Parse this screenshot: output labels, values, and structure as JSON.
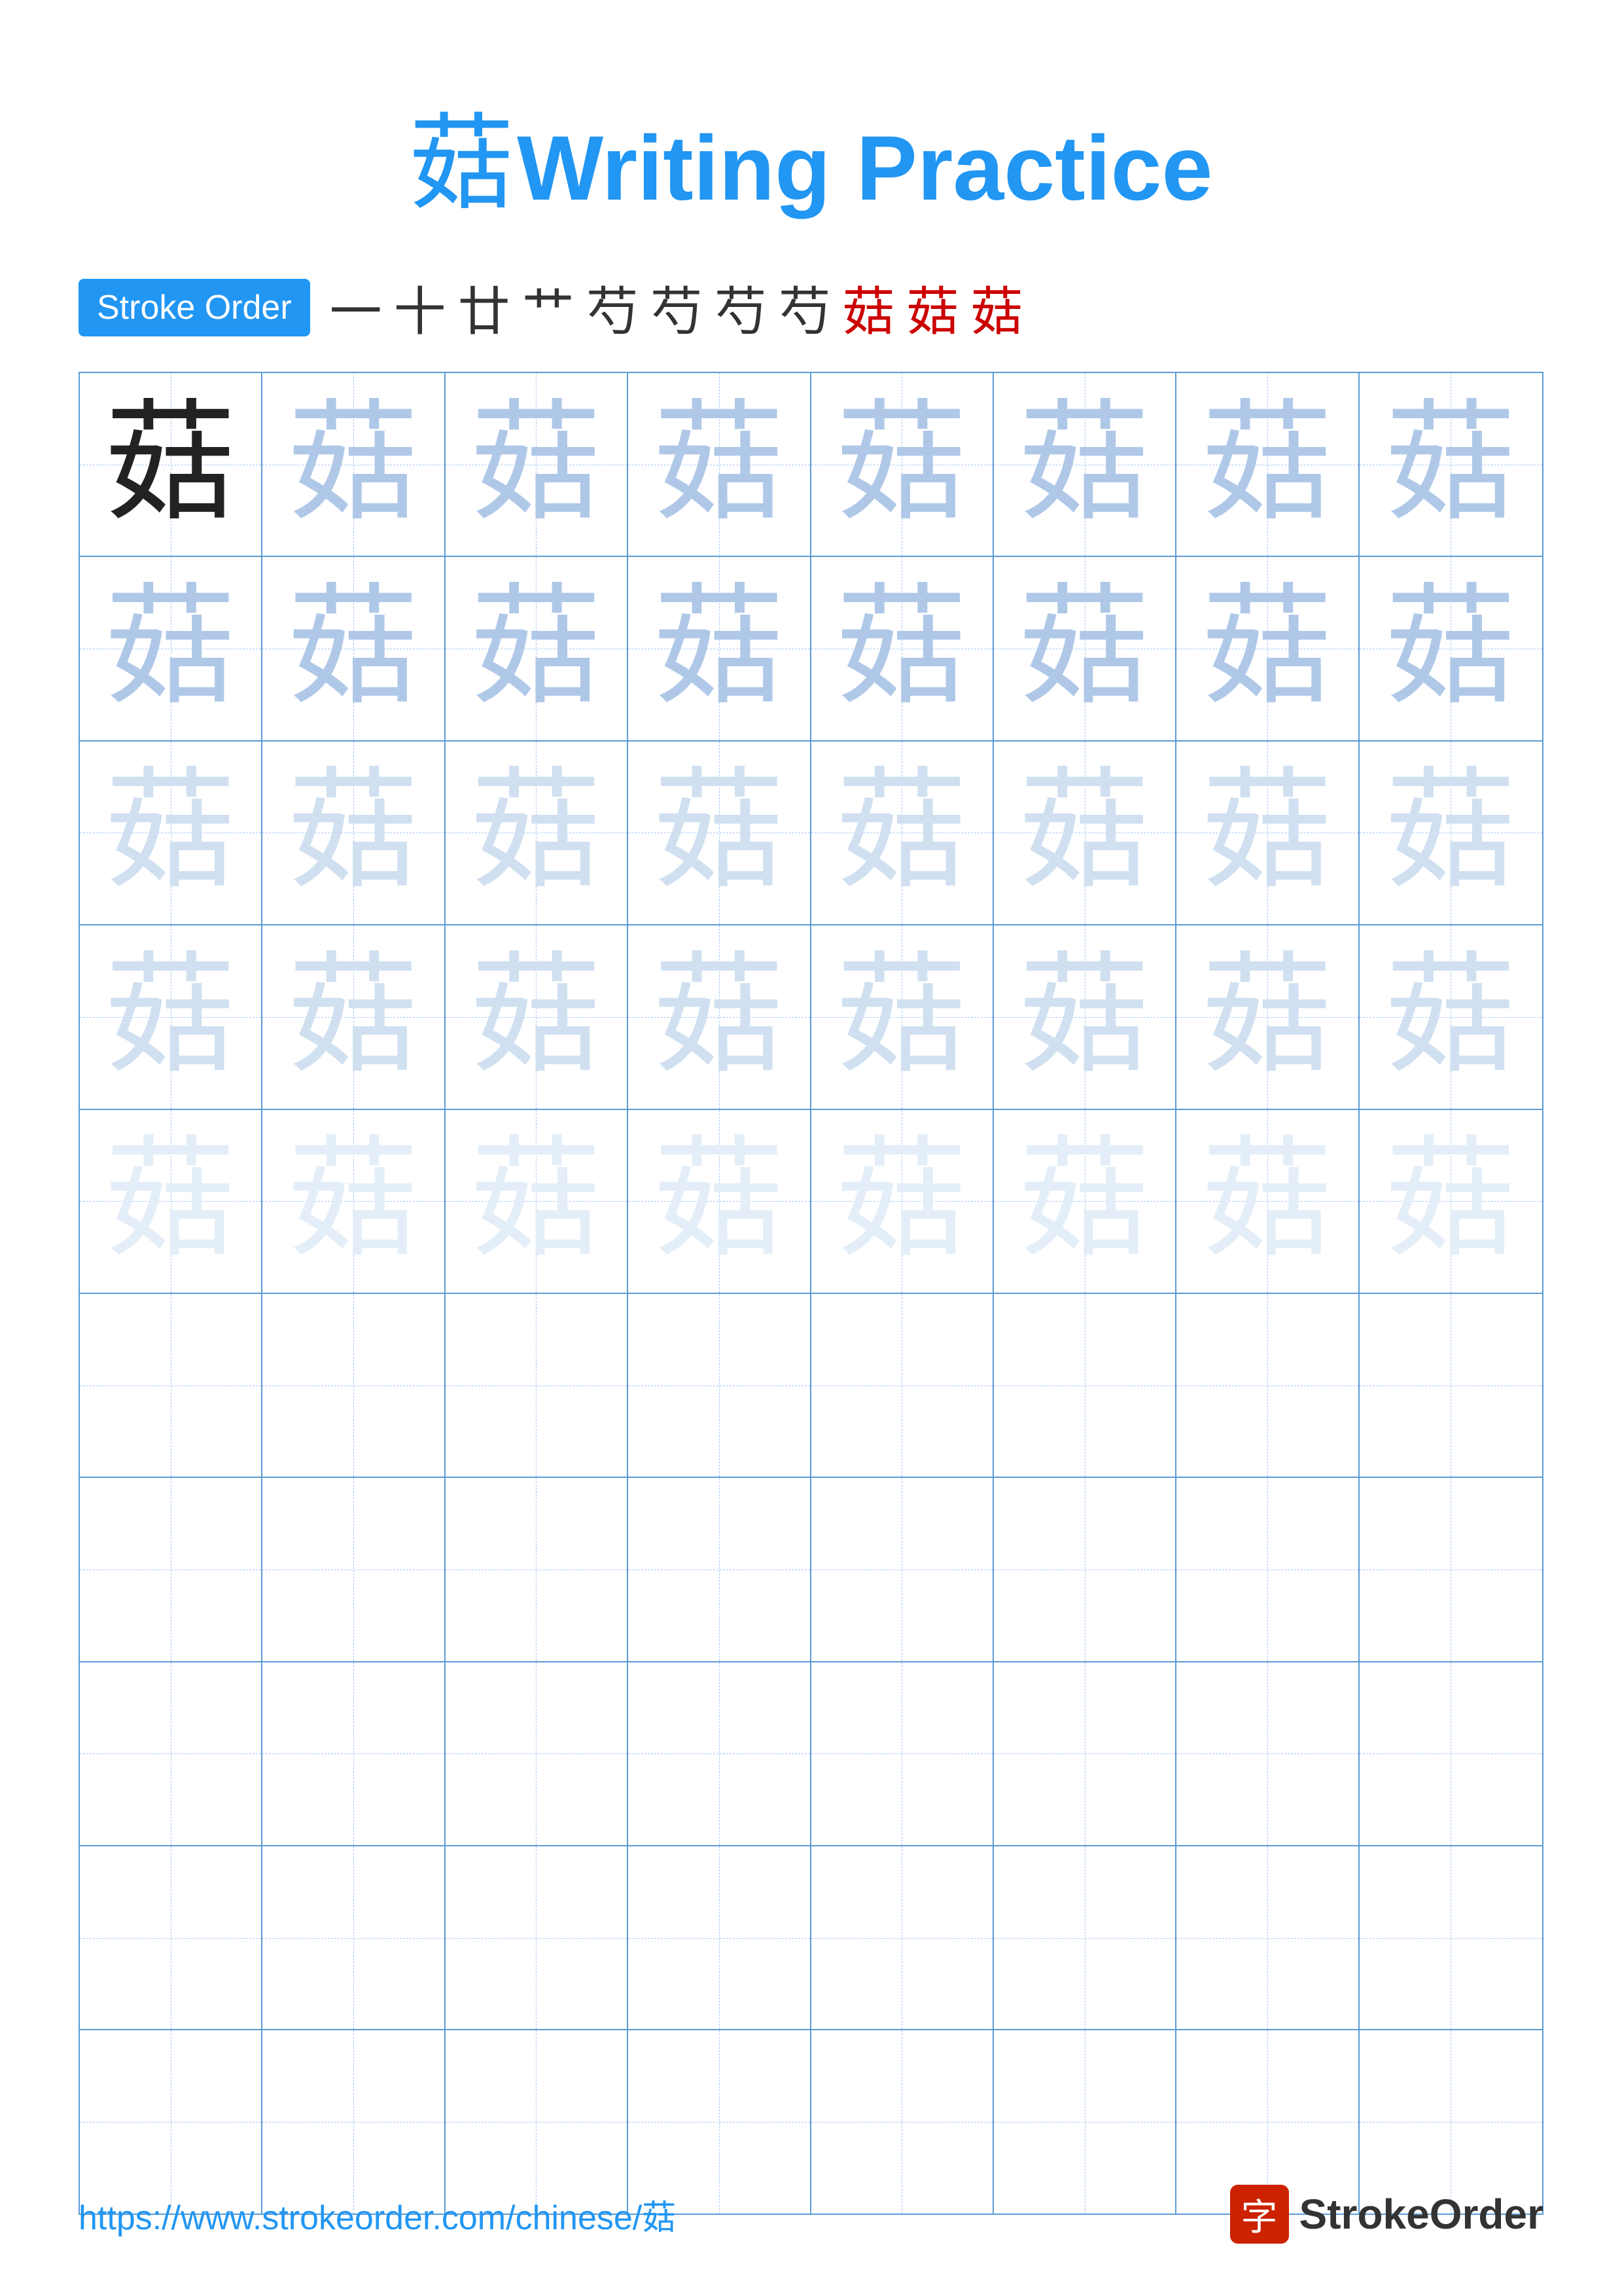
{
  "title": {
    "char": "菇",
    "text": "Writing Practice"
  },
  "stroke_order": {
    "badge": "Stroke Order",
    "chars": [
      "一",
      "十",
      "廿",
      "艹",
      "芍",
      "芍",
      "芍",
      "芍",
      "菇",
      "菇",
      "菇"
    ]
  },
  "grid": {
    "rows": 10,
    "cols": 8,
    "char": "菇",
    "row_styles": [
      [
        "dark",
        "medium",
        "medium",
        "medium",
        "medium",
        "medium",
        "medium",
        "medium"
      ],
      [
        "medium",
        "medium",
        "medium",
        "medium",
        "medium",
        "medium",
        "medium",
        "medium"
      ],
      [
        "light",
        "light",
        "light",
        "light",
        "light",
        "light",
        "light",
        "light"
      ],
      [
        "light",
        "light",
        "light",
        "light",
        "light",
        "light",
        "light",
        "light"
      ],
      [
        "very-light",
        "very-light",
        "very-light",
        "very-light",
        "very-light",
        "very-light",
        "very-light",
        "very-light"
      ],
      [
        "empty",
        "empty",
        "empty",
        "empty",
        "empty",
        "empty",
        "empty",
        "empty"
      ],
      [
        "empty",
        "empty",
        "empty",
        "empty",
        "empty",
        "empty",
        "empty",
        "empty"
      ],
      [
        "empty",
        "empty",
        "empty",
        "empty",
        "empty",
        "empty",
        "empty",
        "empty"
      ],
      [
        "empty",
        "empty",
        "empty",
        "empty",
        "empty",
        "empty",
        "empty",
        "empty"
      ],
      [
        "empty",
        "empty",
        "empty",
        "empty",
        "empty",
        "empty",
        "empty",
        "empty"
      ]
    ]
  },
  "footer": {
    "url": "https://www.strokeorder.com/chinese/菇",
    "logo_char": "字",
    "logo_text": "StrokeOrder"
  }
}
